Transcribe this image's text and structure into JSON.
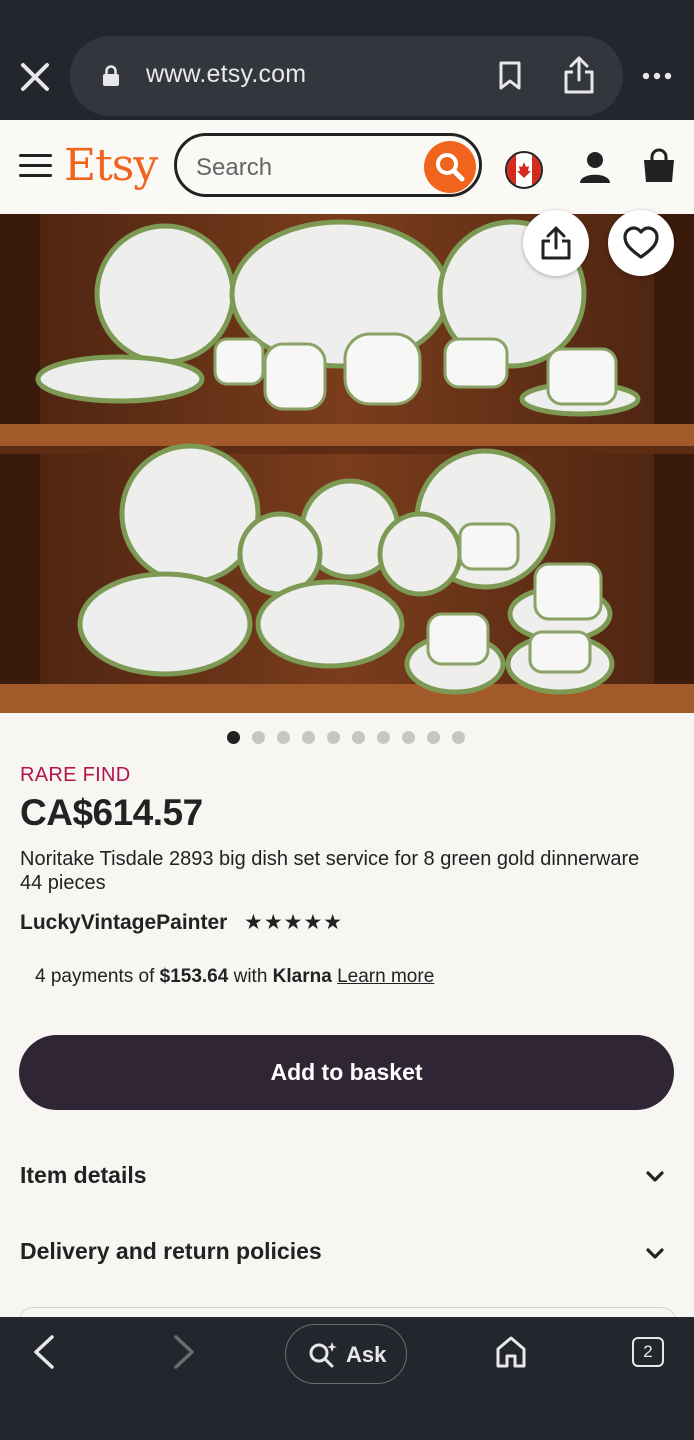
{
  "browser": {
    "url": "www.etsy.com",
    "tab_count": "2",
    "ask_label": "Ask"
  },
  "header": {
    "logo": "Etsy",
    "search_placeholder": "Search"
  },
  "product": {
    "image_count": 10,
    "active_image": 1,
    "badge": "RARE FIND",
    "price": "CA$614.57",
    "title": "Noritake Tisdale 2893 big dish set service for 8 green gold dinnerware 44 pieces",
    "seller": "LuckyVintagePainter",
    "rating_stars": "★★★★★",
    "klarna": {
      "prefix": "4 payments of ",
      "amount": "$153.64",
      "middle": " with ",
      "brand": "Klarna",
      "link": "Learn more"
    },
    "add_to_basket": "Add to basket"
  },
  "sections": [
    {
      "label": "Item details"
    },
    {
      "label": "Delivery and return policies"
    }
  ],
  "colors": {
    "brand": "#f1641e",
    "rare": "#b1134a",
    "button": "#2f2535"
  }
}
